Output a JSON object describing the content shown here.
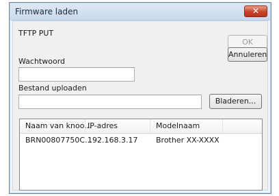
{
  "window": {
    "title": "Firmware laden",
    "close_glyph": "✕"
  },
  "protocol_label": "TFTP PUT",
  "buttons": {
    "ok": "OK",
    "cancel": "Annuleren",
    "browse": "Bladeren..."
  },
  "password": {
    "label": "Wachtwoord",
    "value": ""
  },
  "upload": {
    "label": "Bestand uploaden",
    "value": ""
  },
  "device_list": {
    "columns": [
      "Naam van knoo...",
      "IP-adres",
      "Modelnaam"
    ],
    "rows": [
      [
        "BRN00807750C...",
        "192.168.3.17",
        "Brother XX-XXXX"
      ]
    ]
  },
  "colors": {
    "close_button": "#c7452b",
    "titlebar": "#dfe9f5"
  }
}
